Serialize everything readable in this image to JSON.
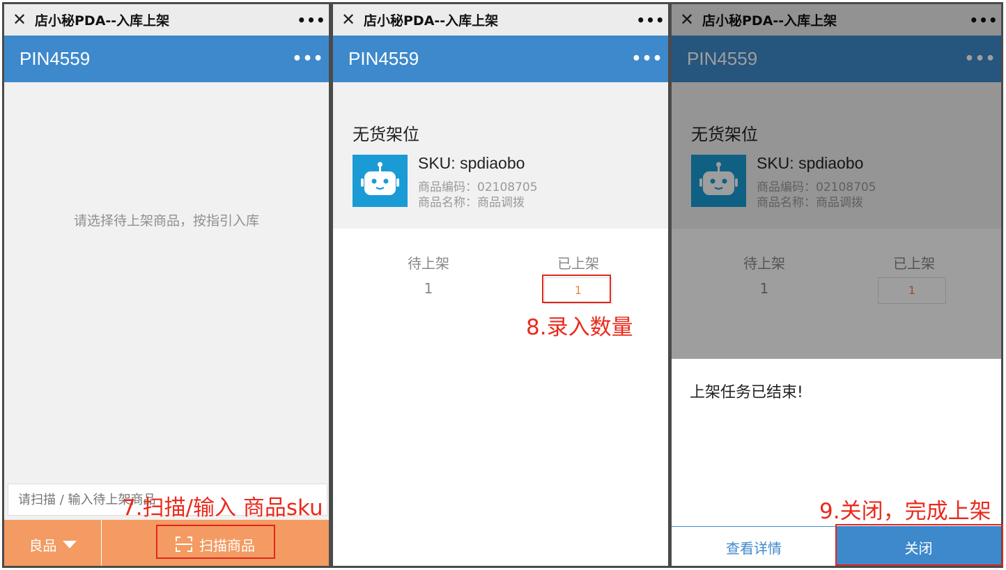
{
  "window_title": "店小秘PDA--入库上架",
  "screens": [
    {
      "header_title": "PIN4559",
      "empty_hint": "请选择待上架商品，按指引入库",
      "scan_placeholder": "请扫描 / 输入待上架商品",
      "quality_label": "良品",
      "scan_button": "扫描商品"
    },
    {
      "header_title": "PIN4559",
      "shelf_title": "无货架位",
      "sku_line": "SKU: spdiaobo",
      "code_line": "商品编码：02108705",
      "name_line": "商品名称：商品调拨",
      "pending_label": "待上架",
      "pending_value": "1",
      "done_label": "已上架",
      "done_value": "1"
    },
    {
      "header_title": "PIN4559",
      "shelf_title": "无货架位",
      "sku_line": "SKU: spdiaobo",
      "code_line": "商品编码：02108705",
      "name_line": "商品名称：商品调拨",
      "pending_label": "待上架",
      "pending_value": "1",
      "done_label": "已上架",
      "done_value": "1",
      "dialog_message": "上架任务已结束!",
      "detail_button": "查看详情",
      "close_button": "关闭"
    }
  ],
  "annotations": {
    "step7": "7.扫描/输入 商品sku",
    "step8": "8.录入数量",
    "step9": "9.关闭，完成上架",
    "color": "#e0261c"
  },
  "icons": {
    "close": "close-x-icon",
    "menu": "more-dots-icon",
    "product": "robot-icon",
    "scan": "scan-frame-icon"
  }
}
